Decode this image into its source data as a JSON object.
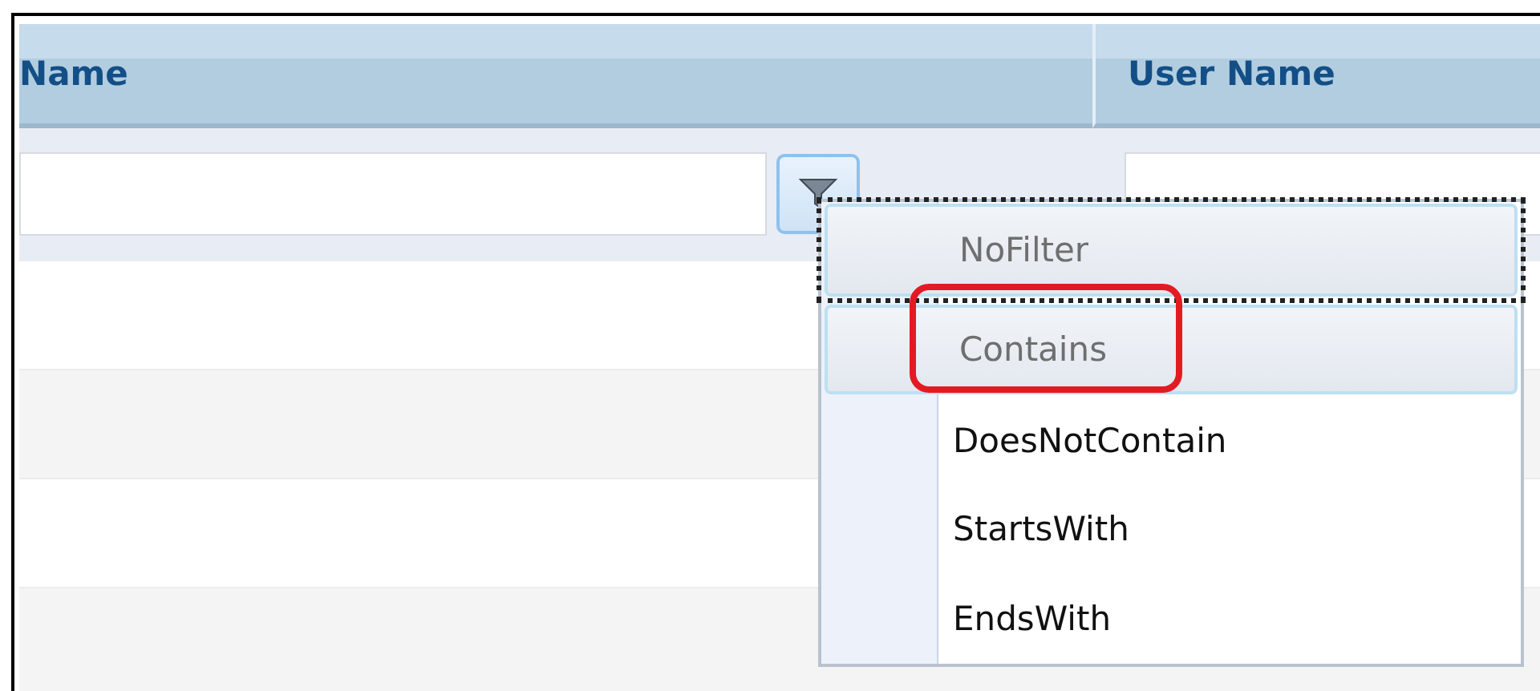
{
  "table": {
    "columns": [
      {
        "label": "Name"
      },
      {
        "label": "User Name"
      }
    ]
  },
  "filter_menu": {
    "items": [
      {
        "label": "NoFilter",
        "highlighted": true,
        "focused": true,
        "annotated": false
      },
      {
        "label": "Contains",
        "highlighted": true,
        "focused": false,
        "annotated": true
      },
      {
        "label": "DoesNotContain",
        "highlighted": false,
        "focused": false,
        "annotated": false
      },
      {
        "label": "StartsWith",
        "highlighted": false,
        "focused": false,
        "annotated": false
      },
      {
        "label": "EndsWith",
        "highlighted": false,
        "focused": false,
        "annotated": false
      }
    ]
  }
}
